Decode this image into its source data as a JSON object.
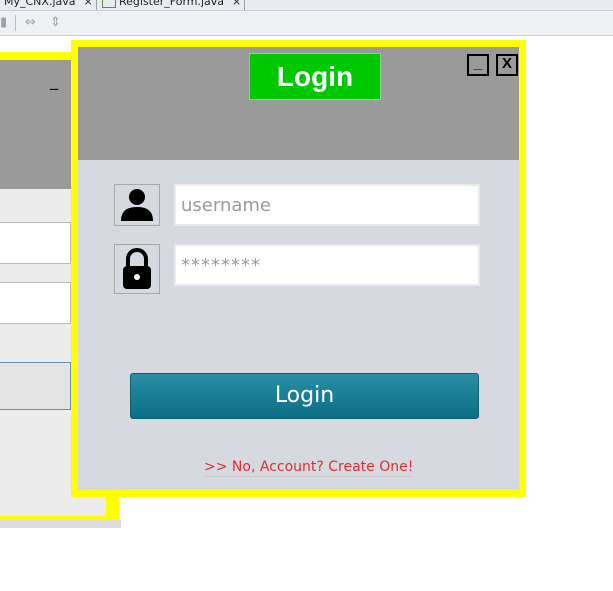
{
  "ide": {
    "tabs": [
      {
        "label": "My_CNX.java"
      },
      {
        "label": "Register_Form.java"
      }
    ],
    "tab_close_glyph": "×",
    "toolbar_icons": [
      "separator-icon",
      "horizontal-resize-icon",
      "vertical-resize-icon"
    ]
  },
  "background_window": {
    "minimize_glyph": "_"
  },
  "login_window": {
    "title": "Login",
    "minimize_label": "_",
    "close_label": "X",
    "username_placeholder": "username",
    "password_value": "********",
    "login_button_label": "Login",
    "create_account_link": ">> No, Account? Create One!",
    "colors": {
      "frame": "#ffff00",
      "header": "#9a9a9a",
      "body": "#d6d9e0",
      "title_badge": "#00c800",
      "login_button": "#1a7e98",
      "link": "#e02d2d"
    },
    "icons": [
      "user-icon",
      "lock-icon"
    ]
  }
}
